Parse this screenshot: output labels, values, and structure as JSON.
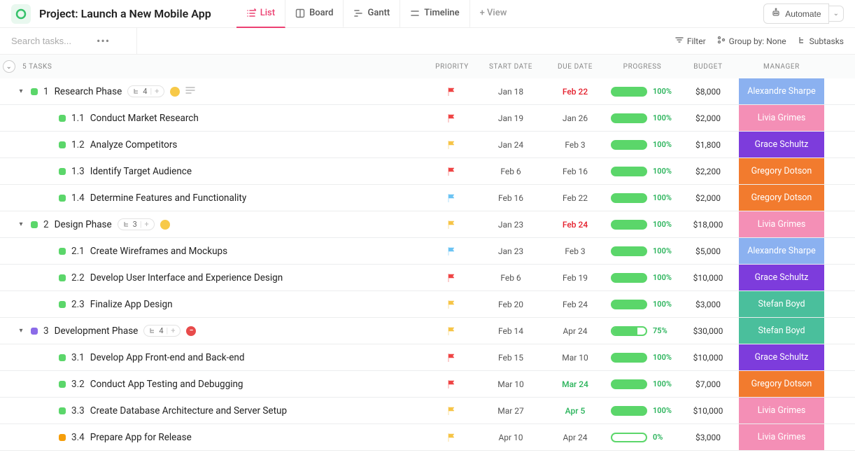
{
  "project_title": "Project: Launch a New Mobile App",
  "views": {
    "list": {
      "label": "List"
    },
    "board": {
      "label": "Board"
    },
    "gantt": {
      "label": "Gantt"
    },
    "timeline": {
      "label": "Timeline"
    },
    "add": {
      "label": "+ View"
    }
  },
  "automate": {
    "label": "Automate"
  },
  "search": {
    "placeholder": "Search tasks..."
  },
  "toolbar": {
    "filter": "Filter",
    "group_by": "Group by: None",
    "subtasks": "Subtasks"
  },
  "columns": {
    "tasks_count": "5 TASKS",
    "priority": "PRIORITY",
    "start_date": "START DATE",
    "due_date": "DUE DATE",
    "progress": "PROGRESS",
    "budget": "BUDGET",
    "manager": "MANAGER"
  },
  "manager_colors": {
    "Alexandre Sharpe": "#8bb1f0",
    "Livia Grimes": "#f48fb6",
    "Grace Schultz": "#7d3cdc",
    "Gregory Dotson": "#f27b2e",
    "Stefan Boyd": "#4abf9c"
  },
  "flag_colors": {
    "red": "#ef4444",
    "yellow": "#f6c446",
    "blue": "#6bc3f3"
  },
  "rows": [
    {
      "level": 0,
      "status": "#5bd66a",
      "wbs": "1",
      "name": "Research Phase",
      "subtasks": 4,
      "sub_badge": "yellow",
      "has_desc": true,
      "flag": "red",
      "start": "Jan 18",
      "due": "Feb 22",
      "due_color": "red",
      "progress": 100,
      "budget": "$8,000",
      "manager": "Alexandre Sharpe"
    },
    {
      "level": 1,
      "status": "#5bd66a",
      "wbs": "1.1",
      "name": "Conduct Market Research",
      "flag": "red",
      "start": "Jan 19",
      "due": "Jan 26",
      "progress": 100,
      "budget": "$2,000",
      "manager": "Livia Grimes"
    },
    {
      "level": 1,
      "status": "#5bd66a",
      "wbs": "1.2",
      "name": "Analyze Competitors",
      "flag": "yellow",
      "start": "Jan 24",
      "due": "Feb 3",
      "progress": 100,
      "budget": "$1,800",
      "manager": "Grace Schultz"
    },
    {
      "level": 1,
      "status": "#5bd66a",
      "wbs": "1.3",
      "name": "Identify Target Audience",
      "flag": "red",
      "start": "Feb 6",
      "due": "Feb 16",
      "progress": 100,
      "budget": "$2,200",
      "manager": "Gregory Dotson"
    },
    {
      "level": 1,
      "status": "#5bd66a",
      "wbs": "1.4",
      "name": "Determine Features and Functionality",
      "flag": "blue",
      "start": "Feb 16",
      "due": "Feb 22",
      "progress": 100,
      "budget": "$2,000",
      "manager": "Gregory Dotson"
    },
    {
      "level": 0,
      "status": "#5bd66a",
      "wbs": "2",
      "name": "Design Phase",
      "subtasks": 3,
      "sub_badge": "yellow",
      "flag": "yellow",
      "start": "Jan 23",
      "due": "Feb 24",
      "due_color": "red",
      "progress": 100,
      "budget": "$18,000",
      "manager": "Livia Grimes"
    },
    {
      "level": 1,
      "status": "#5bd66a",
      "wbs": "2.1",
      "name": "Create Wireframes and Mockups",
      "flag": "blue",
      "start": "Jan 23",
      "due": "Feb 3",
      "progress": 100,
      "budget": "$5,000",
      "manager": "Alexandre Sharpe"
    },
    {
      "level": 1,
      "status": "#5bd66a",
      "wbs": "2.2",
      "name": "Develop User Interface and Experience Design",
      "flag": "red",
      "start": "Feb 6",
      "due": "Feb 19",
      "progress": 100,
      "budget": "$10,000",
      "manager": "Grace Schultz"
    },
    {
      "level": 1,
      "status": "#5bd66a",
      "wbs": "2.3",
      "name": "Finalize App Design",
      "flag": "yellow",
      "start": "Feb 20",
      "due": "Feb 24",
      "progress": 100,
      "budget": "$3,000",
      "manager": "Stefan Boyd"
    },
    {
      "level": 0,
      "status": "#8b6be8",
      "wbs": "3",
      "name": "Development Phase",
      "subtasks": 4,
      "sub_badge": "red",
      "flag": "yellow",
      "start": "Feb 14",
      "due": "Apr 24",
      "progress": 75,
      "budget": "$30,000",
      "manager": "Stefan Boyd"
    },
    {
      "level": 1,
      "status": "#5bd66a",
      "wbs": "3.1",
      "name": "Develop App Front-end and Back-end",
      "flag": "red",
      "start": "Feb 15",
      "due": "Mar 10",
      "progress": 100,
      "budget": "$10,000",
      "manager": "Grace Schultz"
    },
    {
      "level": 1,
      "status": "#5bd66a",
      "wbs": "3.2",
      "name": "Conduct App Testing and Debugging",
      "flag": "red",
      "start": "Mar 10",
      "due": "Mar 24",
      "due_color": "green",
      "progress": 100,
      "budget": "$7,000",
      "manager": "Gregory Dotson"
    },
    {
      "level": 1,
      "status": "#5bd66a",
      "wbs": "3.3",
      "name": "Create Database Architecture and Server Setup",
      "flag": "yellow",
      "start": "Mar 27",
      "due": "Apr 5",
      "due_color": "green",
      "progress": 100,
      "budget": "$10,000",
      "manager": "Livia Grimes"
    },
    {
      "level": 1,
      "status": "#f59e0b",
      "wbs": "3.4",
      "name": "Prepare App for Release",
      "flag": "yellow",
      "start": "Apr 10",
      "due": "Apr 24",
      "progress": 0,
      "budget": "$3,000",
      "manager": "Livia Grimes"
    }
  ]
}
